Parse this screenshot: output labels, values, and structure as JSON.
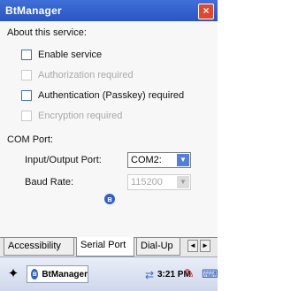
{
  "window": {
    "title": "BtManager",
    "close_glyph": "×"
  },
  "about": {
    "heading": "About this service:",
    "options": [
      {
        "label": "Enable service",
        "checked": false,
        "enabled": true
      },
      {
        "label": "Authorization required",
        "checked": false,
        "enabled": false
      },
      {
        "label": "Authentication (Passkey) required",
        "checked": false,
        "enabled": true
      },
      {
        "label": "Encryption required",
        "checked": false,
        "enabled": false
      }
    ]
  },
  "com": {
    "heading": "COM Port:",
    "io_port_label": "Input/Output Port:",
    "io_port_value": "COM2:",
    "baud_label": "Baud Rate:",
    "baud_value": "115200"
  },
  "tabs": {
    "items": [
      "Accessibility",
      "Serial Port",
      "Dial-Up"
    ],
    "active": "Serial Port",
    "scroll_left": "◄",
    "scroll_right": "►"
  },
  "taskbar": {
    "start_icon": "windows-flag-icon",
    "task_label": "BtManager",
    "clock": "3:21 PM"
  },
  "colors": {
    "title_bar": "#2a55c4",
    "checkbox_border": "#3a6bd5",
    "close": "#e3462c"
  }
}
